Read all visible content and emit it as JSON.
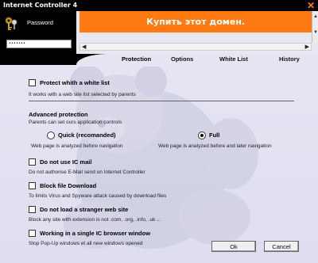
{
  "window": {
    "title": "Internet Controller 4",
    "close_glyph": "✕"
  },
  "login": {
    "password_label": "Password",
    "password_value": "•••••••"
  },
  "banner": {
    "text": "Купить этот домен.",
    "color": "#ff7a12"
  },
  "scroll": {
    "left_glyph": "◀",
    "right_glyph": "▶",
    "up_glyph": "▲",
    "down_glyph": "▼"
  },
  "tabs": [
    "Protection",
    "Options",
    "White List",
    "History"
  ],
  "options": {
    "white_list": {
      "label": "Protect whith a white list",
      "desc": "It works with a web site list selected by parents"
    },
    "advanced": {
      "heading": "Advanced protection",
      "sub": "Parents can set ours application controls",
      "quick": {
        "label": "Quick (recomanded)",
        "desc": "Web page is analyzed before navigation"
      },
      "full": {
        "label": "Full",
        "desc": "Web page is analyzed before and later navigation"
      }
    },
    "ic_mail": {
      "label": "Do not use IC mail",
      "desc": "Do not authorise E-Mail send on Internet Controller"
    },
    "block_download": {
      "label": "Block file Download",
      "desc": "To limits Virus and Spyware attack caused by download files"
    },
    "stranger_site": {
      "label": "Do not load a stranger web site",
      "desc": "Block any site with extension is not .com, .org, .info, .uk ..."
    },
    "single_window": {
      "label": "Working in a single IC browser window",
      "desc": "Stop Pop-Up windows et all new windows opened"
    }
  },
  "buttons": {
    "ok": "Ok",
    "cancel": "Cancel"
  }
}
